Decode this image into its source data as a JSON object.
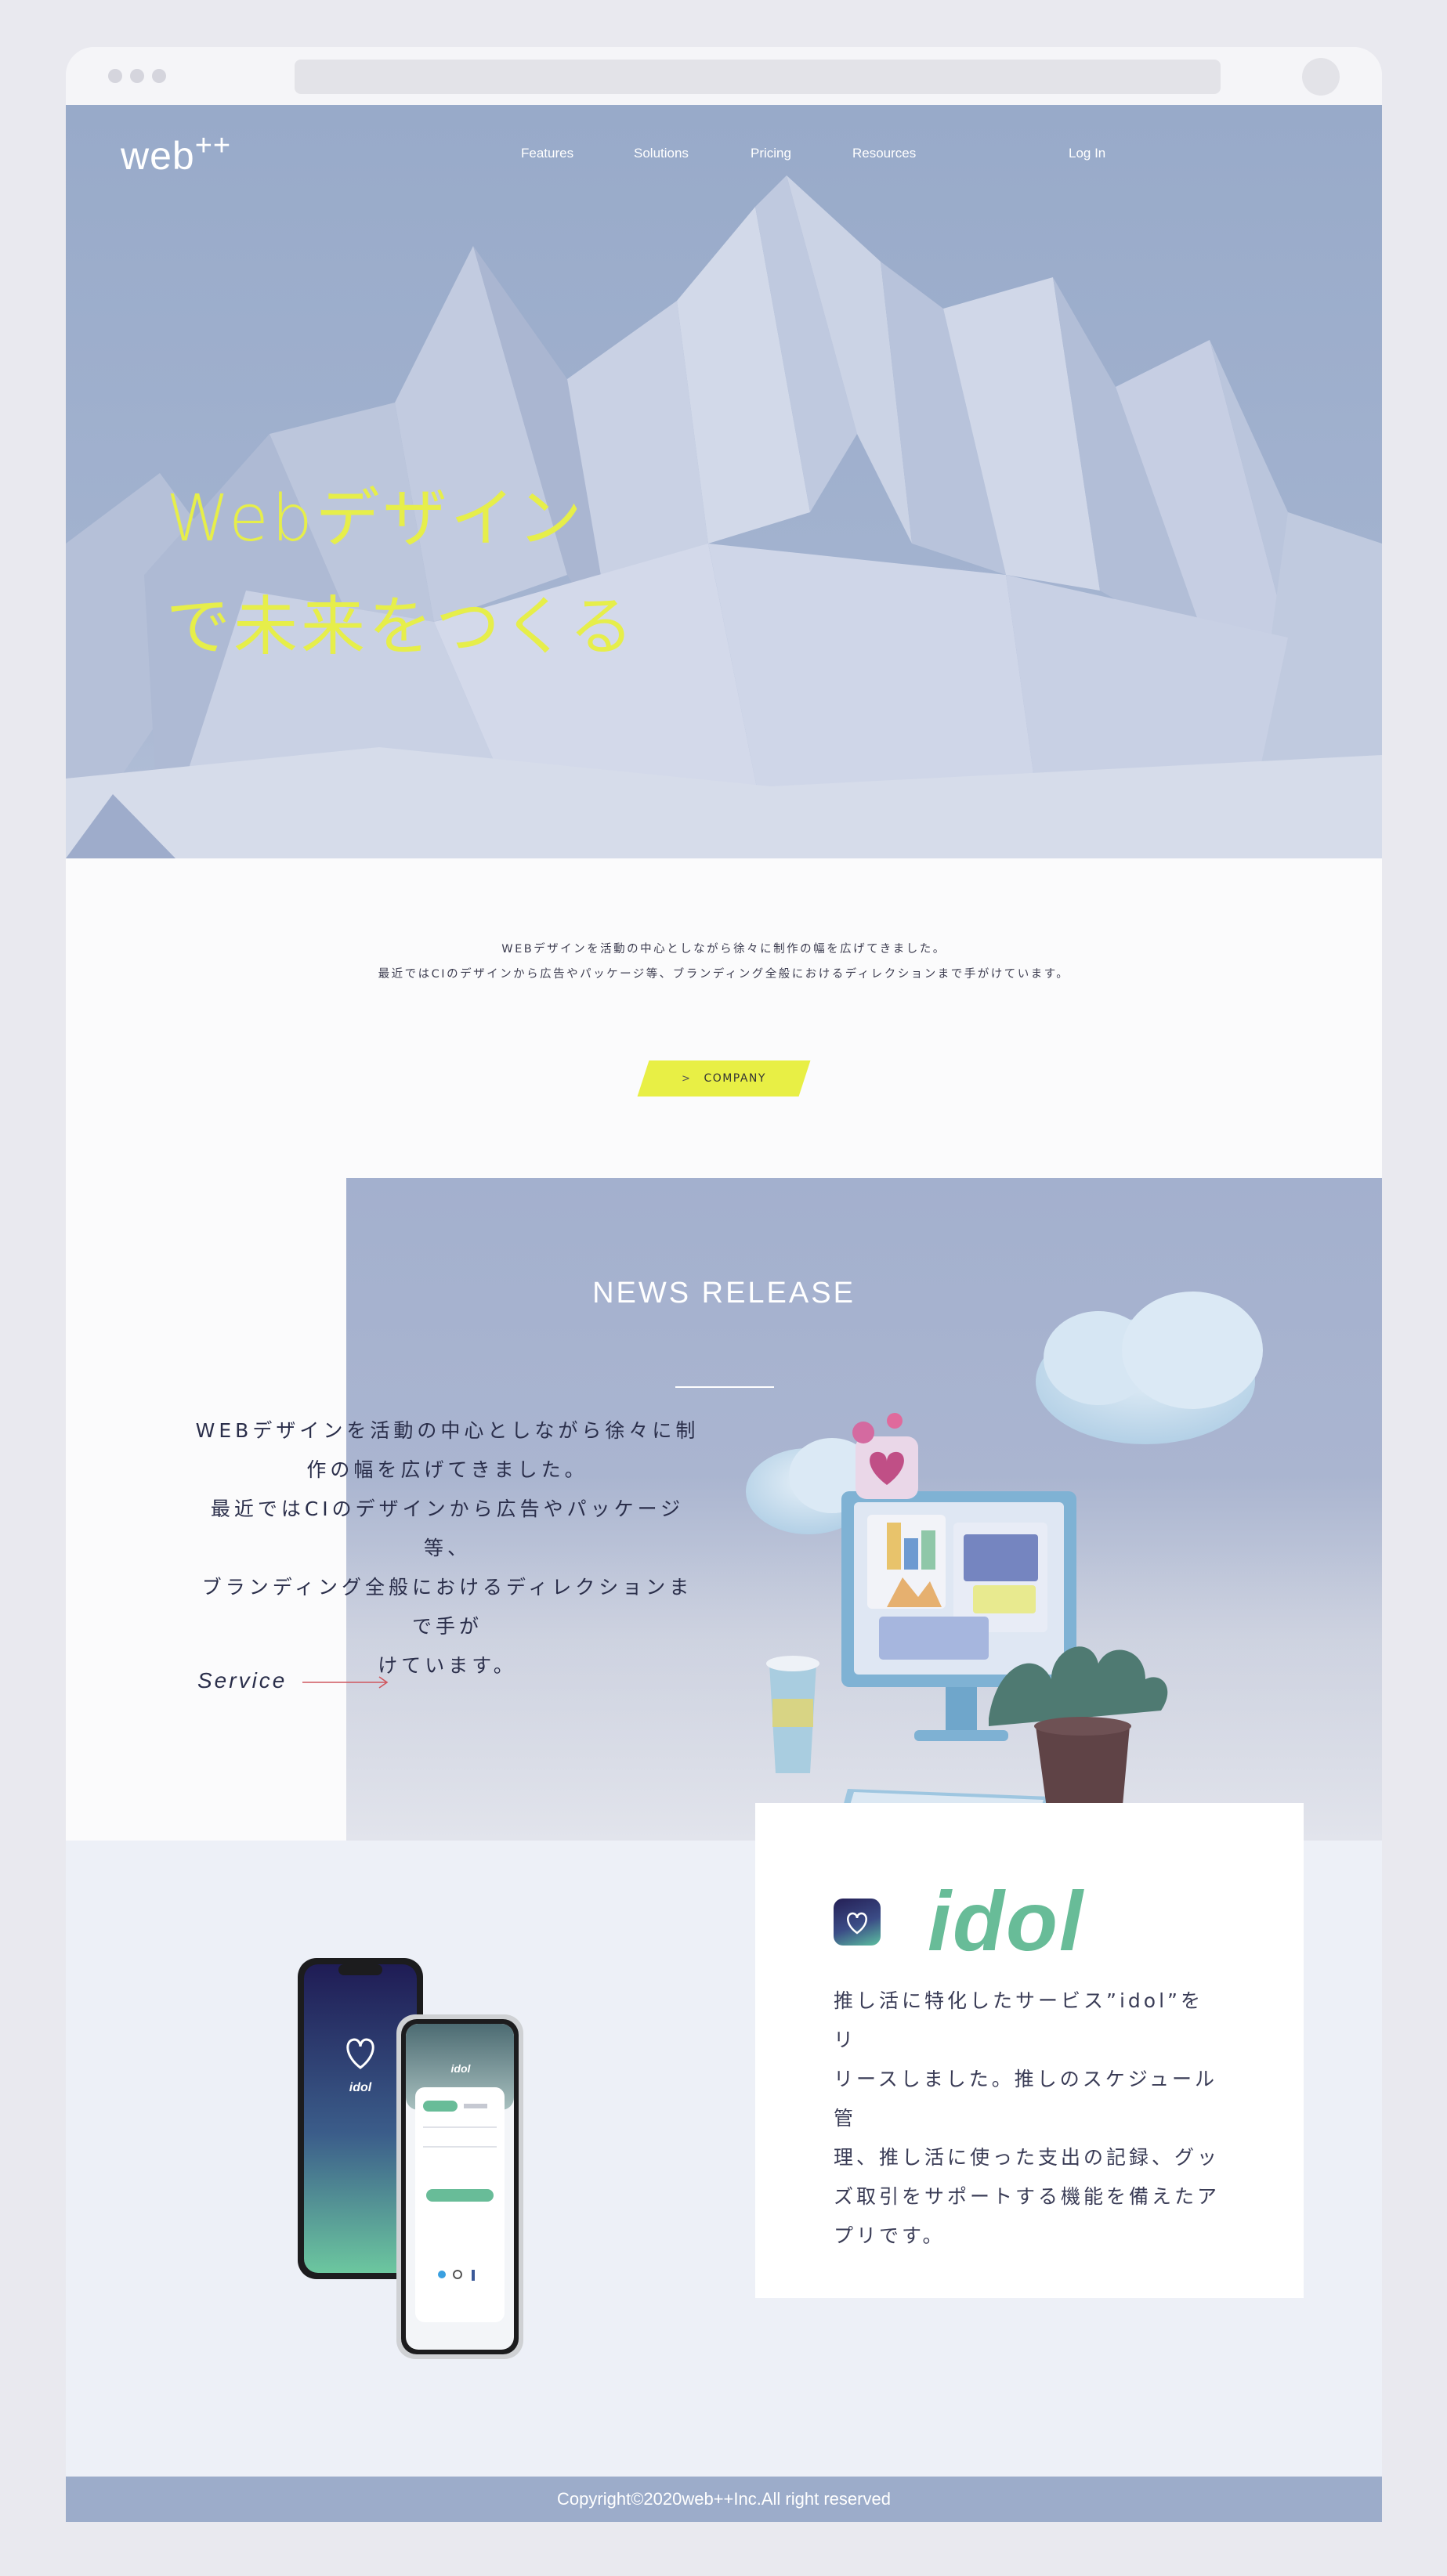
{
  "brand": {
    "name": "web",
    "suffix": "++"
  },
  "nav": {
    "items": [
      "Features",
      "Solutions",
      "Pricing",
      "Resources"
    ],
    "login": "Log In"
  },
  "hero": {
    "line1": "Webデザイン",
    "line2": "で未来をつくる",
    "accent_color": "#e6ee4a"
  },
  "intro": {
    "line1": "WEBデザインを活動の中心としながら徐々に制作の幅を広げてきました。",
    "line2": "最近ではCIのデザインから広告やパッケージ等、ブランディング全般におけるディレクションまで手がけています。",
    "button_label": "COMPANY",
    "button_icon": "chevron-right-icon",
    "button_color": "#e8ef45"
  },
  "news": {
    "title": "NEWS RELEASE",
    "lines": [
      "WEBデザインを活動の中心としながら徐々に制",
      "作の幅を広げてきました。",
      "最近ではCIのデザインから広告やパッケージ等、",
      "ブランディング全般におけるディレクションまで手が",
      "けています。"
    ],
    "link_label": "Service",
    "link_icon": "arrow-right-icon"
  },
  "idol": {
    "name": "idol",
    "name_color": "#68bc98",
    "phone_label": "idol",
    "lines": [
      "推し活に特化したサービス”idol”をリ",
      "リースしました。推しのスケジュール管",
      "理、推し活に使った支出の記録、グッ",
      "ズ取引をサポートする機能を備えたア",
      "プリです。"
    ]
  },
  "footer": {
    "copyright": "Copyright©2020web++Inc.All right reserved"
  }
}
